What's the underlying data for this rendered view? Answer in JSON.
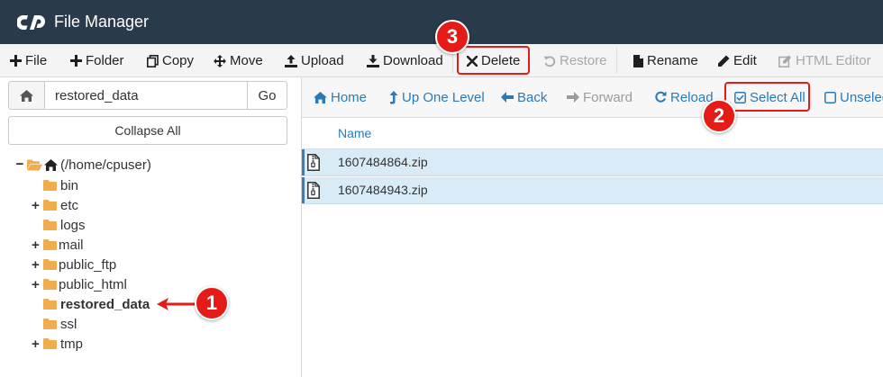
{
  "header": {
    "title": "File Manager"
  },
  "toolbar": {
    "file": "File",
    "folder": "Folder",
    "copy": "Copy",
    "move": "Move",
    "upload": "Upload",
    "download": "Download",
    "delete": "Delete",
    "restore": "Restore",
    "rename": "Rename",
    "edit": "Edit",
    "html_editor": "HTML Editor"
  },
  "left_panel": {
    "path_value": "restored_data",
    "go_label": "Go",
    "collapse_label": "Collapse All",
    "tree": {
      "root": "(/home/cpuser)",
      "items": [
        "bin",
        "etc",
        "logs",
        "mail",
        "public_ftp",
        "public_html",
        "restored_data",
        "ssl",
        "tmp"
      ]
    }
  },
  "nav": {
    "home": "Home",
    "up": "Up One Level",
    "back": "Back",
    "forward": "Forward",
    "reload": "Reload",
    "select_all": "Select All",
    "unselect": "Unselec"
  },
  "table": {
    "name_header": "Name",
    "files": [
      "1607484864.zip",
      "1607484943.zip"
    ]
  },
  "annotations": {
    "step1": "1",
    "step2": "2",
    "step3": "3"
  },
  "colors": {
    "header": "#293a4a",
    "accent_blue": "#2a7ab8",
    "callout_red": "#e41b17",
    "row_selected": "#d9ebf7",
    "folder": "#f0ad4e"
  }
}
